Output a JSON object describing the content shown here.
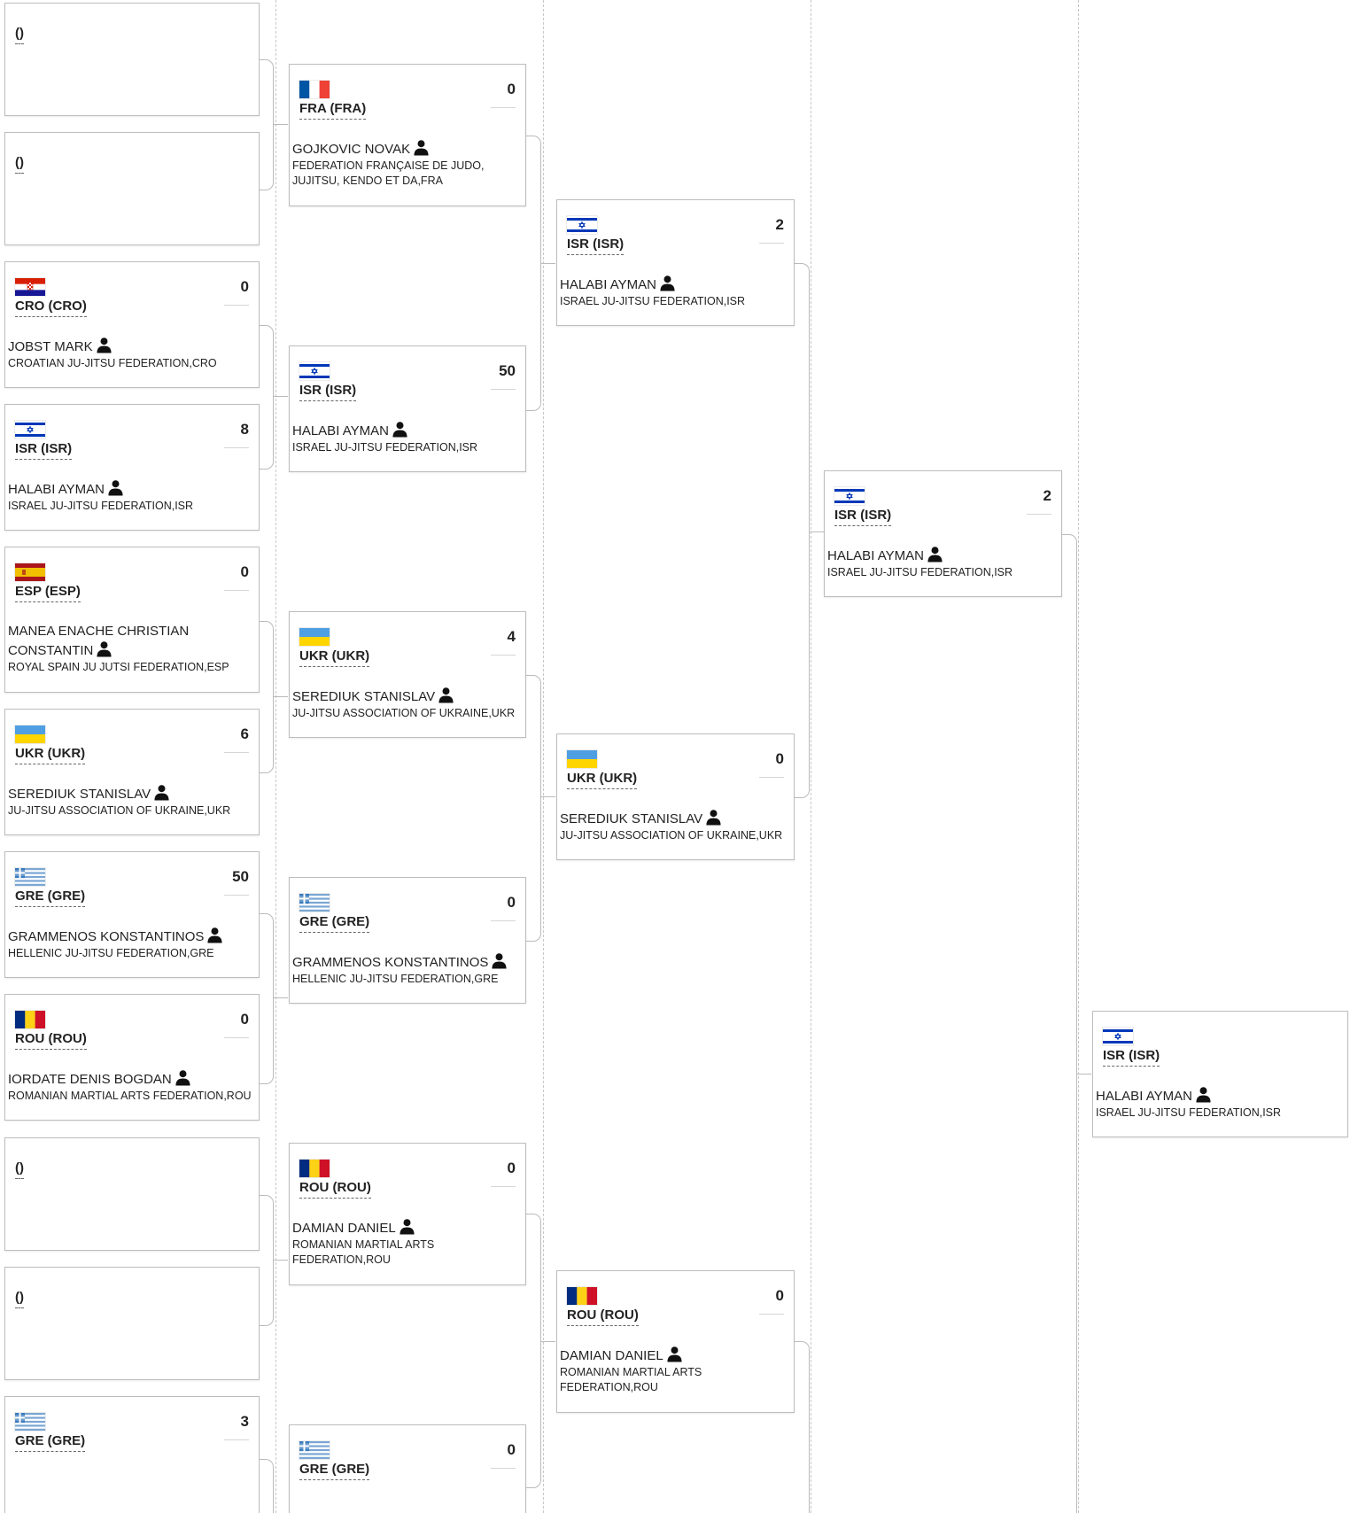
{
  "colors": {
    "card_border": "#bdbdbd",
    "connector": "#bbbbbb",
    "separator": "#c8c8c8"
  },
  "flags": {
    "FRA": {
      "type": "vertical",
      "stripes": [
        "#0055a4",
        "#ffffff",
        "#ef4135"
      ]
    },
    "ISR": {
      "type": "israel",
      "stripes": [
        "#0038b8",
        "#ffffff"
      ]
    },
    "CRO": {
      "type": "horizontal",
      "stripes": [
        "#d81e05",
        "#ffffff",
        "#171796"
      ]
    },
    "ESP": {
      "type": "horizontal-spain",
      "stripes": [
        "#aa151b",
        "#f1bf00",
        "#aa151b"
      ]
    },
    "UKR": {
      "type": "horizontal",
      "stripes": [
        "#4f9fe3",
        "#ffd500"
      ]
    },
    "GRE": {
      "type": "greece",
      "stripes": [
        "#0d5eaf",
        "#ffffff"
      ]
    },
    "ROU": {
      "type": "vertical",
      "stripes": [
        "#002b7f",
        "#fcd116",
        "#ce1126"
      ]
    }
  },
  "rounds": [
    {
      "matches": [
        {
          "country": "()",
          "score": "",
          "empty": true
        },
        {
          "country": "()",
          "score": "",
          "empty": true
        },
        {
          "country": "CRO (CRO)",
          "flag": "CRO",
          "score": "0",
          "name": "JOBST MARK",
          "federation": "CROATIAN JU-JITSU FEDERATION,CRO"
        },
        {
          "country": "ISR (ISR)",
          "flag": "ISR",
          "score": "8",
          "name": "HALABI AYMAN",
          "federation": "ISRAEL JU-JITSU FEDERATION,ISR"
        },
        {
          "country": "ESP (ESP)",
          "flag": "ESP",
          "score": "0",
          "name": "MANEA ENACHE CHRISTIAN CONSTANTIN",
          "federation": "ROYAL SPAIN JU JUTSI FEDERATION,ESP"
        },
        {
          "country": "UKR (UKR)",
          "flag": "UKR",
          "score": "6",
          "name": "SEREDIUK STANISLAV",
          "federation": "JU-JITSU ASSOCIATION OF UKRAINE,UKR"
        },
        {
          "country": "GRE (GRE)",
          "flag": "GRE",
          "score": "50",
          "name": "GRAMMENOS KONSTANTINOS",
          "federation": "HELLENIC JU-JITSU FEDERATION,GRE"
        },
        {
          "country": "ROU (ROU)",
          "flag": "ROU",
          "score": "0",
          "name": "IORDATE DENIS BOGDAN",
          "federation": "ROMANIAN MARTIAL ARTS FEDERATION,ROU"
        },
        {
          "country": "()",
          "score": "",
          "empty": true
        },
        {
          "country": "()",
          "score": "",
          "empty": true
        },
        {
          "country": "GRE (GRE)",
          "flag": "GRE",
          "score": "3",
          "name": "",
          "federation": ""
        }
      ]
    },
    {
      "matches": [
        {
          "country": "FRA (FRA)",
          "flag": "FRA",
          "score": "0",
          "name": "GOJKOVIC NOVAK",
          "federation": "FEDERATION FRANÇAISE DE JUDO, JUJITSU, KENDO ET DA,FRA"
        },
        {
          "country": "ISR (ISR)",
          "flag": "ISR",
          "score": "50",
          "name": "HALABI AYMAN",
          "federation": "ISRAEL JU-JITSU FEDERATION,ISR"
        },
        {
          "country": "UKR (UKR)",
          "flag": "UKR",
          "score": "4",
          "name": "SEREDIUK STANISLAV",
          "federation": "JU-JITSU ASSOCIATION OF UKRAINE,UKR"
        },
        {
          "country": "GRE (GRE)",
          "flag": "GRE",
          "score": "0",
          "name": "GRAMMENOS KONSTANTINOS",
          "federation": "HELLENIC JU-JITSU FEDERATION,GRE"
        },
        {
          "country": "ROU (ROU)",
          "flag": "ROU",
          "score": "0",
          "name": "DAMIAN DANIEL",
          "federation": "ROMANIAN MARTIAL ARTS FEDERATION,ROU"
        },
        {
          "country": "GRE (GRE)",
          "flag": "GRE",
          "score": "0",
          "name": "",
          "federation": ""
        }
      ]
    },
    {
      "matches": [
        {
          "country": "ISR (ISR)",
          "flag": "ISR",
          "score": "2",
          "name": "HALABI AYMAN",
          "federation": "ISRAEL JU-JITSU FEDERATION,ISR"
        },
        {
          "country": "UKR (UKR)",
          "flag": "UKR",
          "score": "0",
          "name": "SEREDIUK STANISLAV",
          "federation": "JU-JITSU ASSOCIATION OF UKRAINE,UKR"
        },
        {
          "country": "ROU (ROU)",
          "flag": "ROU",
          "score": "0",
          "name": "DAMIAN DANIEL",
          "federation": "ROMANIAN MARTIAL ARTS FEDERATION,ROU"
        }
      ]
    },
    {
      "matches": [
        {
          "country": "ISR (ISR)",
          "flag": "ISR",
          "score": "2",
          "name": "HALABI AYMAN",
          "federation": "ISRAEL JU-JITSU FEDERATION,ISR"
        }
      ]
    },
    {
      "matches": [
        {
          "country": "ISR (ISR)",
          "flag": "ISR",
          "score": "",
          "name": "HALABI AYMAN",
          "federation": "ISRAEL JU-JITSU FEDERATION,ISR"
        }
      ]
    }
  ]
}
